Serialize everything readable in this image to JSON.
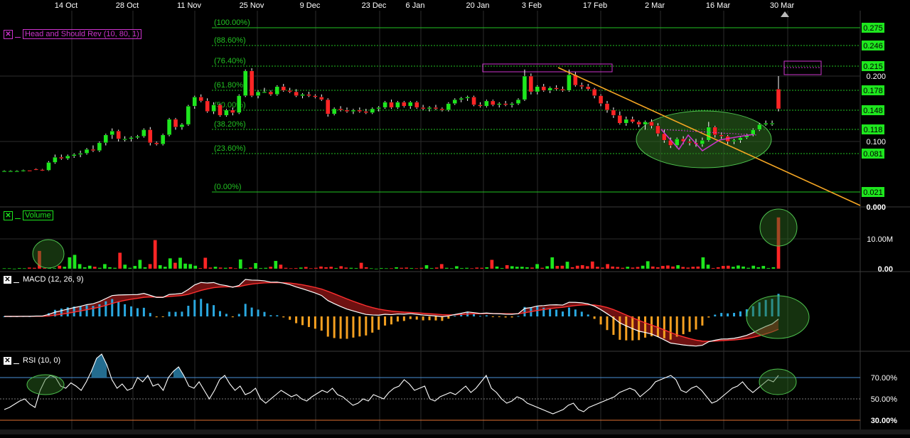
{
  "colors": {
    "bg": "#000000",
    "grid": "#2b2b2b",
    "up": "#1ee61e",
    "down": "#ff2525",
    "fib": "#22c322",
    "fibLabel": "#22c322",
    "axis": "#ffffff",
    "trend": "#f5a623",
    "pattern": "#cc33cc",
    "ellipseFill": "#2f6f21",
    "ellipseStroke": "#4ec24e",
    "macdLine": "#ffffff",
    "signalLine": "#ff3030",
    "histPos": "#2aa8e0",
    "histNeg": "#f5a020",
    "rsiLine": "#ffffff",
    "rsiFill": "#2a7fa8",
    "rsi70": "#4a90d9",
    "rsi50": "#7a7a7a",
    "rsi30": "#e07030",
    "priceTagBg": "#1ee61e"
  },
  "date_labels": [
    "14 Oct",
    "28 Oct",
    "11 Nov",
    "25 Nov",
    "9 Dec",
    "23 Dec",
    "6 Jan",
    "20 Jan",
    "3 Feb",
    "17 Feb",
    "2 Mar",
    "16 Mar",
    "30 Mar"
  ],
  "price_pane": {
    "legend": {
      "icon": "close-icon",
      "label": "Head and Should Rev (10, 80, 1)"
    },
    "axis_ticks": [
      "0.200",
      "0.100",
      "0.000"
    ],
    "fib_levels": [
      {
        "pct": "(100.00%)",
        "value": "0.275"
      },
      {
        "pct": "(88.60%)",
        "value": "0.246"
      },
      {
        "pct": "(76.40%)",
        "value": "0.215"
      },
      {
        "pct": "(61.80%)",
        "value": "0.178"
      },
      {
        "pct": "(50.00%)",
        "value": "0.148"
      },
      {
        "pct": "(38.20%)",
        "value": "0.118"
      },
      {
        "pct": "(23.60%)",
        "value": "0.081"
      },
      {
        "pct": "(0.00%)",
        "value": "0.021"
      }
    ]
  },
  "volume_pane": {
    "legend": {
      "icon": "close-icon",
      "label": "Volume"
    },
    "axis_ticks": [
      "10.00M",
      "0.00"
    ]
  },
  "macd_pane": {
    "legend": {
      "icon": "close-icon",
      "label": "MACD (12, 26, 9)"
    }
  },
  "rsi_pane": {
    "legend": {
      "icon": "close-icon",
      "label": "RSI (10, 0)"
    },
    "axis_ticks": [
      "70.00%",
      "50.00%",
      "30.00%"
    ]
  },
  "chart_data": {
    "type": "candlestick",
    "symbol": "",
    "price_axis_range": [
      0,
      0.3
    ],
    "candles_ohlc": [
      [
        0.055,
        0.056,
        0.054,
        0.055
      ],
      [
        0.055,
        0.056,
        0.054,
        0.055
      ],
      [
        0.055,
        0.056,
        0.054,
        0.055
      ],
      [
        0.055,
        0.057,
        0.054,
        0.056
      ],
      [
        0.056,
        0.056,
        0.055,
        0.055
      ],
      [
        0.058,
        0.059,
        0.056,
        0.057
      ],
      [
        0.057,
        0.058,
        0.055,
        0.056
      ],
      [
        0.056,
        0.07,
        0.055,
        0.068
      ],
      [
        0.068,
        0.08,
        0.066,
        0.076
      ],
      [
        0.076,
        0.08,
        0.072,
        0.074
      ],
      [
        0.074,
        0.08,
        0.072,
        0.078
      ],
      [
        0.078,
        0.082,
        0.075,
        0.08
      ],
      [
        0.08,
        0.086,
        0.076,
        0.082
      ],
      [
        0.082,
        0.09,
        0.08,
        0.088
      ],
      [
        0.088,
        0.094,
        0.084,
        0.086
      ],
      [
        0.086,
        0.1,
        0.084,
        0.098
      ],
      [
        0.098,
        0.112,
        0.094,
        0.11
      ],
      [
        0.11,
        0.12,
        0.104,
        0.116
      ],
      [
        0.116,
        0.118,
        0.1,
        0.104
      ],
      [
        0.104,
        0.108,
        0.1,
        0.104
      ],
      [
        0.104,
        0.108,
        0.1,
        0.106
      ],
      [
        0.106,
        0.11,
        0.104,
        0.108
      ],
      [
        0.108,
        0.12,
        0.106,
        0.118
      ],
      [
        0.118,
        0.122,
        0.094,
        0.098
      ],
      [
        0.098,
        0.1,
        0.094,
        0.096
      ],
      [
        0.096,
        0.112,
        0.094,
        0.11
      ],
      [
        0.11,
        0.136,
        0.108,
        0.134
      ],
      [
        0.134,
        0.136,
        0.118,
        0.122
      ],
      [
        0.122,
        0.128,
        0.118,
        0.126
      ],
      [
        0.126,
        0.156,
        0.124,
        0.154
      ],
      [
        0.154,
        0.17,
        0.15,
        0.168
      ],
      [
        0.168,
        0.172,
        0.16,
        0.162
      ],
      [
        0.162,
        0.166,
        0.144,
        0.146
      ],
      [
        0.146,
        0.16,
        0.142,
        0.156
      ],
      [
        0.156,
        0.158,
        0.138,
        0.14
      ],
      [
        0.14,
        0.15,
        0.138,
        0.148
      ],
      [
        0.148,
        0.152,
        0.14,
        0.144
      ],
      [
        0.144,
        0.172,
        0.142,
        0.17
      ],
      [
        0.17,
        0.21,
        0.168,
        0.208
      ],
      [
        0.208,
        0.212,
        0.168,
        0.17
      ],
      [
        0.17,
        0.178,
        0.166,
        0.176
      ],
      [
        0.176,
        0.182,
        0.174,
        0.176
      ],
      [
        0.176,
        0.178,
        0.17,
        0.172
      ],
      [
        0.172,
        0.186,
        0.17,
        0.184
      ],
      [
        0.184,
        0.188,
        0.176,
        0.178
      ],
      [
        0.178,
        0.182,
        0.174,
        0.176
      ],
      [
        0.176,
        0.18,
        0.168,
        0.17
      ],
      [
        0.17,
        0.174,
        0.166,
        0.172
      ],
      [
        0.172,
        0.176,
        0.168,
        0.17
      ],
      [
        0.17,
        0.172,
        0.166,
        0.168
      ],
      [
        0.168,
        0.172,
        0.162,
        0.164
      ],
      [
        0.164,
        0.166,
        0.138,
        0.142
      ],
      [
        0.142,
        0.152,
        0.14,
        0.15
      ],
      [
        0.15,
        0.154,
        0.146,
        0.148
      ],
      [
        0.148,
        0.152,
        0.144,
        0.146
      ],
      [
        0.146,
        0.15,
        0.142,
        0.148
      ],
      [
        0.148,
        0.152,
        0.144,
        0.146
      ],
      [
        0.146,
        0.15,
        0.142,
        0.144
      ],
      [
        0.144,
        0.152,
        0.142,
        0.15
      ],
      [
        0.15,
        0.154,
        0.146,
        0.152
      ],
      [
        0.152,
        0.162,
        0.15,
        0.16
      ],
      [
        0.16,
        0.164,
        0.15,
        0.152
      ],
      [
        0.152,
        0.162,
        0.15,
        0.16
      ],
      [
        0.16,
        0.162,
        0.152,
        0.154
      ],
      [
        0.154,
        0.162,
        0.15,
        0.16
      ],
      [
        0.16,
        0.162,
        0.15,
        0.152
      ],
      [
        0.152,
        0.156,
        0.148,
        0.15
      ],
      [
        0.15,
        0.154,
        0.146,
        0.152
      ],
      [
        0.152,
        0.156,
        0.148,
        0.15
      ],
      [
        0.15,
        0.152,
        0.146,
        0.148
      ],
      [
        0.148,
        0.16,
        0.146,
        0.158
      ],
      [
        0.158,
        0.166,
        0.156,
        0.164
      ],
      [
        0.164,
        0.168,
        0.16,
        0.166
      ],
      [
        0.166,
        0.17,
        0.162,
        0.168
      ],
      [
        0.168,
        0.17,
        0.154,
        0.156
      ],
      [
        0.156,
        0.16,
        0.152,
        0.154
      ],
      [
        0.154,
        0.164,
        0.152,
        0.162
      ],
      [
        0.162,
        0.164,
        0.154,
        0.156
      ],
      [
        0.156,
        0.16,
        0.152,
        0.158
      ],
      [
        0.158,
        0.162,
        0.154,
        0.156
      ],
      [
        0.156,
        0.16,
        0.152,
        0.158
      ],
      [
        0.158,
        0.166,
        0.156,
        0.164
      ],
      [
        0.164,
        0.21,
        0.162,
        0.2
      ],
      [
        0.2,
        0.204,
        0.172,
        0.176
      ],
      [
        0.176,
        0.186,
        0.172,
        0.184
      ],
      [
        0.184,
        0.188,
        0.176,
        0.178
      ],
      [
        0.178,
        0.184,
        0.174,
        0.182
      ],
      [
        0.182,
        0.186,
        0.178,
        0.18
      ],
      [
        0.18,
        0.184,
        0.176,
        0.178
      ],
      [
        0.178,
        0.21,
        0.176,
        0.202
      ],
      [
        0.202,
        0.206,
        0.184,
        0.186
      ],
      [
        0.186,
        0.19,
        0.18,
        0.184
      ],
      [
        0.184,
        0.188,
        0.178,
        0.18
      ],
      [
        0.18,
        0.182,
        0.166,
        0.17
      ],
      [
        0.17,
        0.172,
        0.154,
        0.158
      ],
      [
        0.158,
        0.162,
        0.144,
        0.148
      ],
      [
        0.148,
        0.152,
        0.136,
        0.14
      ],
      [
        0.14,
        0.146,
        0.126,
        0.128
      ],
      [
        0.128,
        0.138,
        0.124,
        0.134
      ],
      [
        0.134,
        0.138,
        0.128,
        0.13
      ],
      [
        0.13,
        0.132,
        0.122,
        0.126
      ],
      [
        0.126,
        0.132,
        0.118,
        0.13
      ],
      [
        0.13,
        0.134,
        0.12,
        0.124
      ],
      [
        0.124,
        0.128,
        0.108,
        0.112
      ],
      [
        0.112,
        0.118,
        0.098,
        0.102
      ],
      [
        0.102,
        0.106,
        0.09,
        0.094
      ],
      [
        0.094,
        0.106,
        0.09,
        0.104
      ],
      [
        0.104,
        0.108,
        0.096,
        0.1
      ],
      [
        0.1,
        0.104,
        0.094,
        0.098
      ],
      [
        0.098,
        0.104,
        0.092,
        0.096
      ],
      [
        0.096,
        0.106,
        0.092,
        0.102
      ],
      [
        0.102,
        0.13,
        0.1,
        0.122
      ],
      [
        0.122,
        0.124,
        0.106,
        0.11
      ],
      [
        0.11,
        0.114,
        0.104,
        0.108
      ],
      [
        0.108,
        0.11,
        0.096,
        0.1
      ],
      [
        0.1,
        0.104,
        0.096,
        0.102
      ],
      [
        0.102,
        0.108,
        0.098,
        0.106
      ],
      [
        0.106,
        0.112,
        0.104,
        0.11
      ],
      [
        0.11,
        0.12,
        0.108,
        0.118
      ],
      [
        0.118,
        0.128,
        0.116,
        0.126
      ],
      [
        0.126,
        0.132,
        0.124,
        0.128
      ],
      [
        0.128,
        0.132,
        0.124,
        0.128
      ],
      [
        0.18,
        0.2,
        0.146,
        0.15
      ]
    ],
    "volumes_M": [
      0.2,
      0.2,
      0.1,
      0.3,
      0.2,
      0.5,
      0.4,
      6.8,
      0.3,
      0.4,
      0.3,
      1.2,
      0.8,
      4.4,
      5.3,
      1.8,
      0.6,
      1.2,
      0.8,
      0.4,
      1.8,
      0.6,
      0.4,
      6.1,
      1.6,
      0.4,
      1.1,
      3.4,
      0.6,
      1.8,
      10.9,
      1.4,
      0.8,
      4.0,
      2.3,
      4.2,
      2.0,
      1.8,
      1.2,
      0.3,
      4.2,
      0.5,
      0.8,
      0.5,
      0.4,
      0.6,
      0.2,
      3.6,
      0.2,
      0.5,
      2.2,
      0.3,
      0.4,
      0.8,
      3.0,
      1.6,
      0.4,
      0.2,
      0.3,
      0.5,
      0.7,
      0.2,
      0.4,
      0.9,
      0.6,
      0.8,
      0.3,
      1.0,
      0.5,
      0.4,
      0.3,
      2.3,
      0.6,
      0.2,
      0.1,
      0.3,
      0.2,
      0.2,
      0.6,
      0.4,
      0.5,
      0.3,
      0.2,
      0.4,
      1.4,
      0.3,
      0.5,
      1.8,
      0.4,
      0.2,
      1.0,
      0.3,
      0.4,
      0.2,
      0.5,
      0.4,
      0.6,
      3.4,
      0.9,
      0.3,
      1.4,
      1.0,
      0.8,
      0.8,
      0.6,
      0.5,
      1.8,
      0.4,
      1.0,
      4.4,
      1.1,
      1.2,
      2.7,
      0.6,
      1.2,
      1.4,
      1.0,
      2.8,
      0.8,
      0.5,
      1.8,
      0.9,
      0.7,
      0.4,
      0.8,
      0.5,
      0.7,
      1.2,
      2.9,
      0.9,
      0.6,
      1.1,
      1.3,
      0.9,
      1.4,
      0.7,
      0.5,
      0.8,
      0.9,
      4.4,
      1.6,
      0.3,
      0.6,
      1.1,
      1.2,
      0.8,
      1.3,
      0.9,
      0.4,
      1.2,
      0.6,
      1.1,
      0.3,
      0.6,
      19.5
    ],
    "rsi": [
      40,
      42,
      45,
      48,
      50,
      45,
      42,
      58,
      68,
      72,
      70,
      62,
      60,
      65,
      62,
      58,
      66,
      76,
      88,
      92,
      82,
      68,
      60,
      64,
      58,
      60,
      70,
      66,
      72,
      62,
      64,
      58,
      70,
      76,
      80,
      72,
      62,
      60,
      66,
      58,
      50,
      58,
      68,
      72,
      64,
      58,
      62,
      54,
      56,
      60,
      50,
      46,
      50,
      54,
      58,
      55,
      52,
      54,
      50,
      48,
      52,
      55,
      58,
      56,
      60,
      54,
      52,
      48,
      44,
      46,
      50,
      48,
      54,
      52,
      50,
      56,
      60,
      62,
      68,
      64,
      58,
      60,
      62,
      50,
      48,
      52,
      54,
      56,
      54,
      58,
      62,
      56,
      60,
      66,
      72,
      60,
      56,
      50,
      46,
      48,
      52,
      50,
      46,
      44,
      42,
      40,
      38,
      36,
      38,
      40,
      44,
      46,
      40,
      38,
      42,
      44,
      46,
      48,
      50,
      52,
      56,
      58,
      60,
      58,
      52,
      56,
      60,
      66,
      68,
      70,
      72,
      68,
      58,
      56,
      60,
      62,
      58,
      52,
      46,
      48,
      52,
      56,
      60,
      62,
      66,
      60,
      56,
      60,
      64,
      68,
      66,
      72
    ]
  }
}
